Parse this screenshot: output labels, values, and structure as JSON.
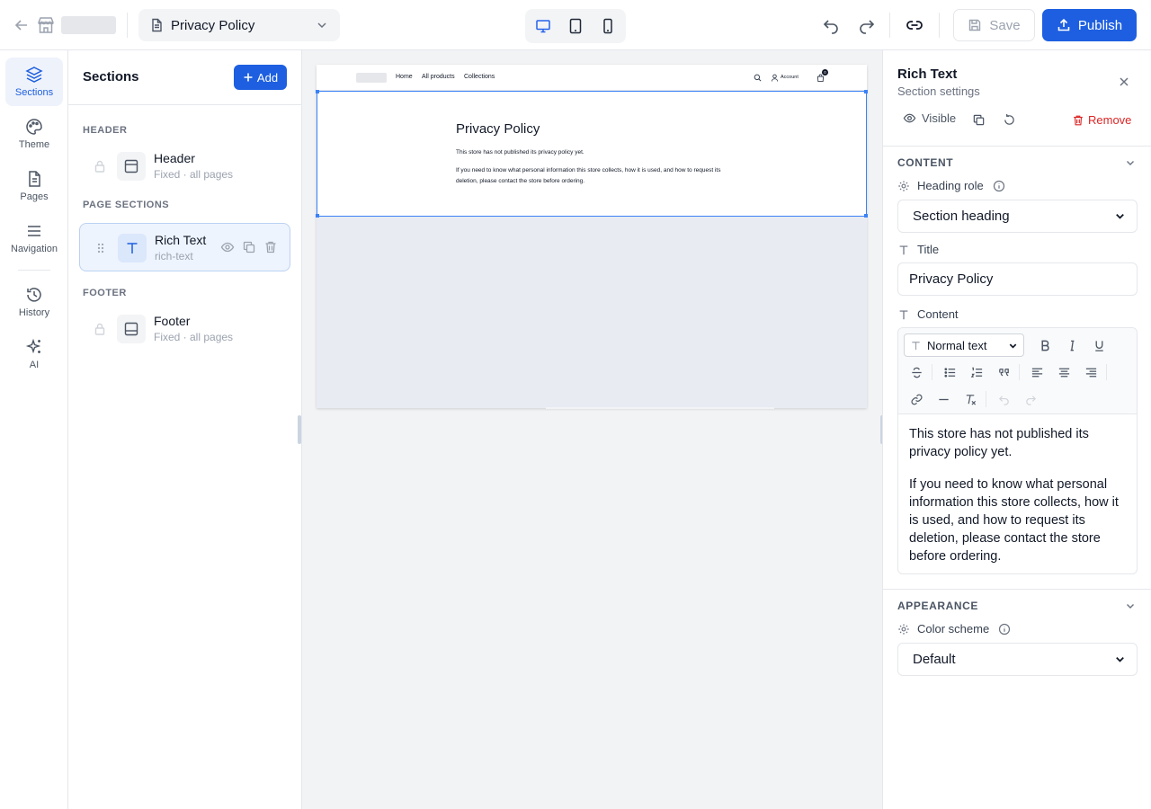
{
  "topbar": {
    "page_name": "Privacy Policy",
    "save_label": "Save",
    "publish_label": "Publish"
  },
  "rail": {
    "items": [
      {
        "label": "Sections",
        "icon": "layers-icon"
      },
      {
        "label": "Theme",
        "icon": "palette-icon"
      },
      {
        "label": "Pages",
        "icon": "file-icon"
      },
      {
        "label": "Navigation",
        "icon": "menu-icon"
      },
      {
        "label": "History",
        "icon": "history-icon"
      },
      {
        "label": "AI",
        "icon": "sparkles-icon"
      }
    ]
  },
  "sections": {
    "title": "Sections",
    "add_label": "Add",
    "groups": {
      "header": "HEADER",
      "page": "PAGE SECTIONS",
      "footer": "FOOTER"
    },
    "header_item": {
      "name": "Header",
      "sub": "Fixed · all pages"
    },
    "rich_item": {
      "name": "Rich Text",
      "sub": "rich-text"
    },
    "footer_item": {
      "name": "Footer",
      "sub": "Fixed · all pages"
    }
  },
  "preview": {
    "nav": [
      "Home",
      "All products",
      "Collections"
    ],
    "account": "Account",
    "cart_count": "0",
    "heading": "Privacy Policy",
    "p1": "This store has not published its privacy policy yet.",
    "p2": "If you need to know what personal information this store collects, how it is used, and how to request its deletion, please contact the store before ordering."
  },
  "settings": {
    "title": "Rich Text",
    "subtitle": "Section settings",
    "visible_label": "Visible",
    "remove_label": "Remove",
    "content_cat": "CONTENT",
    "heading_role_label": "Heading role",
    "heading_role_value": "Section heading",
    "title_label": "Title",
    "title_value": "Privacy Policy",
    "content_label": "Content",
    "text_style": "Normal text",
    "content_p1": "This store has not published its privacy policy yet.",
    "content_p2": "If you need to know what personal information this store collects, how it is used, and how to request its deletion, please contact the store before ordering.",
    "appearance_cat": "APPEARANCE",
    "color_scheme_label": "Color scheme",
    "color_scheme_value": "Default"
  },
  "colors": {
    "accent": "#1d5fe0",
    "danger": "#dc2626",
    "selection": "#3b82f6"
  }
}
